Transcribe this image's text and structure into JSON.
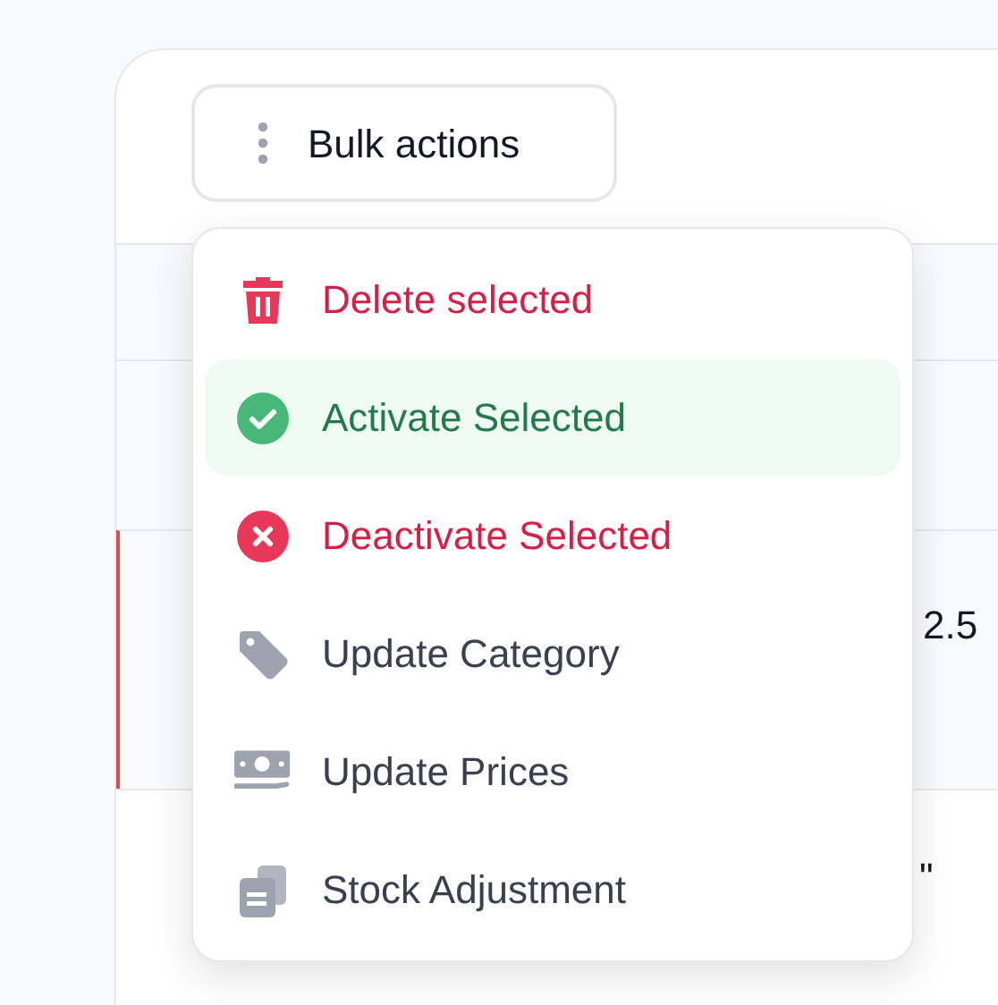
{
  "bulk_button": {
    "label": "Bulk actions"
  },
  "table": {
    "rows": [
      {
        "selected": false
      },
      {
        "selected": true,
        "column_3": "2.5"
      },
      {
        "selected": false,
        "column_3": "\""
      }
    ]
  },
  "menu": {
    "items": [
      {
        "label": "Delete selected",
        "kind": "delete",
        "color": "#d61f45",
        "selected": false
      },
      {
        "label": "Activate Selected",
        "kind": "activate",
        "color": "#237a4b",
        "selected": true
      },
      {
        "label": "Deactivate Selected",
        "kind": "deactivate",
        "color": "#d61f45",
        "selected": false
      },
      {
        "label": "Update Category",
        "kind": "category",
        "color": "#374151",
        "selected": false
      },
      {
        "label": "Update Prices",
        "kind": "prices",
        "color": "#374151",
        "selected": false
      },
      {
        "label": "Stock Adjustment",
        "kind": "stock",
        "color": "#374151",
        "selected": false
      }
    ]
  }
}
